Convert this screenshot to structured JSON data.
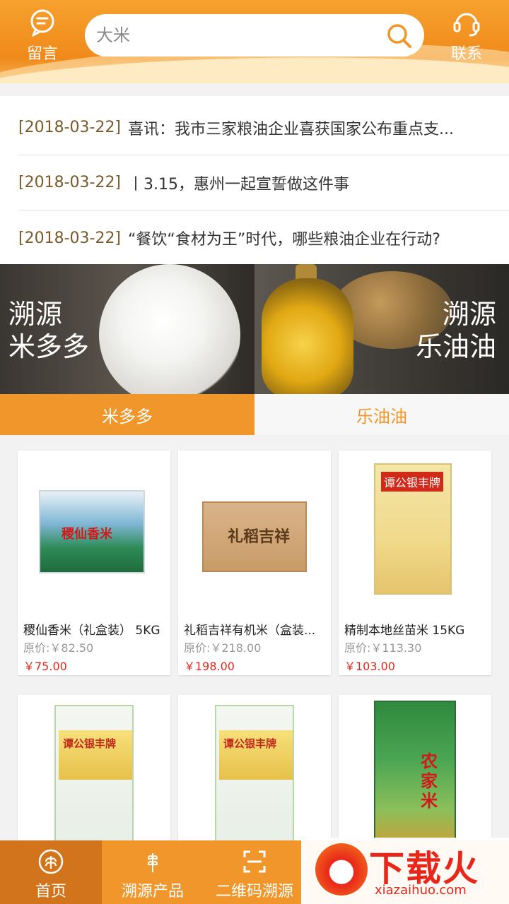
{
  "header": {
    "message_label": "留言",
    "contact_label": "联系",
    "search": {
      "placeholder": "大米"
    }
  },
  "news": [
    {
      "date": "[2018-03-22]",
      "title": "喜讯：我市三家粮油企业喜获国家公布重点支..."
    },
    {
      "date": "[2018-03-22]",
      "title": "丨3.15，惠州一起宣誓做这件事"
    },
    {
      "date": "[2018-03-22]",
      "title": "“餐饮“食材为王”时代，哪些粮油企业在行动?"
    }
  ],
  "banner": {
    "left_line1": "溯源",
    "left_line2": "米多多",
    "right_line1": "溯源",
    "right_line2": "乐油油"
  },
  "tabs": [
    {
      "label": "米多多",
      "active": true
    },
    {
      "label": "乐油油",
      "active": false
    }
  ],
  "products": [
    {
      "name": "稷仙香米（礼盒装） 5KG",
      "orig": "原价:￥82.50",
      "price": "￥75.00",
      "pkg_text": "稷仙香米"
    },
    {
      "name": "礼稻吉祥有机米（盒装...",
      "orig": "原价:￥218.00",
      "price": "￥198.00",
      "pkg_text": "礼稻吉祥"
    },
    {
      "name": "精制本地丝苗米 15KG",
      "orig": "原价:￥113.30",
      "price": "￥103.00",
      "pkg_text": "谭公银丰牌"
    },
    {
      "name": "",
      "orig": "",
      "price": "",
      "pkg_text": "谭公银丰牌"
    },
    {
      "name": "",
      "orig": "",
      "price": "",
      "pkg_text": "谭公银丰牌"
    },
    {
      "name": "",
      "orig": "",
      "price": "",
      "pkg_text": "农家米"
    }
  ],
  "bottom_nav": [
    {
      "label": "首页",
      "active": true
    },
    {
      "label": "溯源产品",
      "active": false
    },
    {
      "label": "二维码溯源",
      "active": false
    }
  ],
  "watermark": {
    "big": "下载火",
    "small": "xiazaihuo.com"
  },
  "colors": {
    "accent": "#f0962a",
    "price": "#e8261a",
    "date": "#7a5a2a"
  }
}
